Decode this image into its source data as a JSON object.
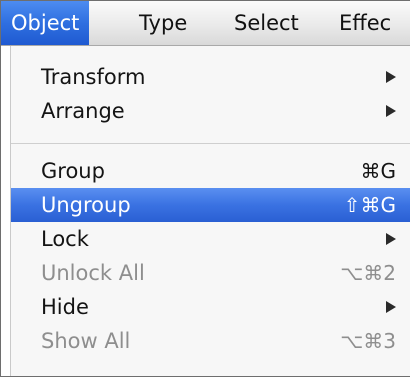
{
  "menubar": {
    "items": [
      {
        "label": "Object",
        "active": true
      },
      {
        "label": "Type",
        "active": false
      },
      {
        "label": "Select",
        "active": false
      },
      {
        "label": "Effec",
        "active": false
      }
    ]
  },
  "menu": {
    "items": [
      {
        "label": "Transform",
        "shortcut": "",
        "submenu": true,
        "disabled": false,
        "highlighted": false
      },
      {
        "label": "Arrange",
        "shortcut": "",
        "submenu": true,
        "disabled": false,
        "highlighted": false
      },
      {
        "label": "Group",
        "shortcut": "⌘G",
        "submenu": false,
        "disabled": false,
        "highlighted": false
      },
      {
        "label": "Ungroup",
        "shortcut": "⇧⌘G",
        "submenu": false,
        "disabled": false,
        "highlighted": true
      },
      {
        "label": "Lock",
        "shortcut": "",
        "submenu": true,
        "disabled": false,
        "highlighted": false
      },
      {
        "label": "Unlock All",
        "shortcut": "⌥⌘2",
        "submenu": false,
        "disabled": true,
        "highlighted": false
      },
      {
        "label": "Hide",
        "shortcut": "",
        "submenu": true,
        "disabled": false,
        "highlighted": false
      },
      {
        "label": "Show All",
        "shortcut": "⌥⌘3",
        "submenu": false,
        "disabled": true,
        "highlighted": false
      }
    ]
  },
  "colors": {
    "highlight": "#3a72e2",
    "disabled_text": "#8e8e8e"
  }
}
